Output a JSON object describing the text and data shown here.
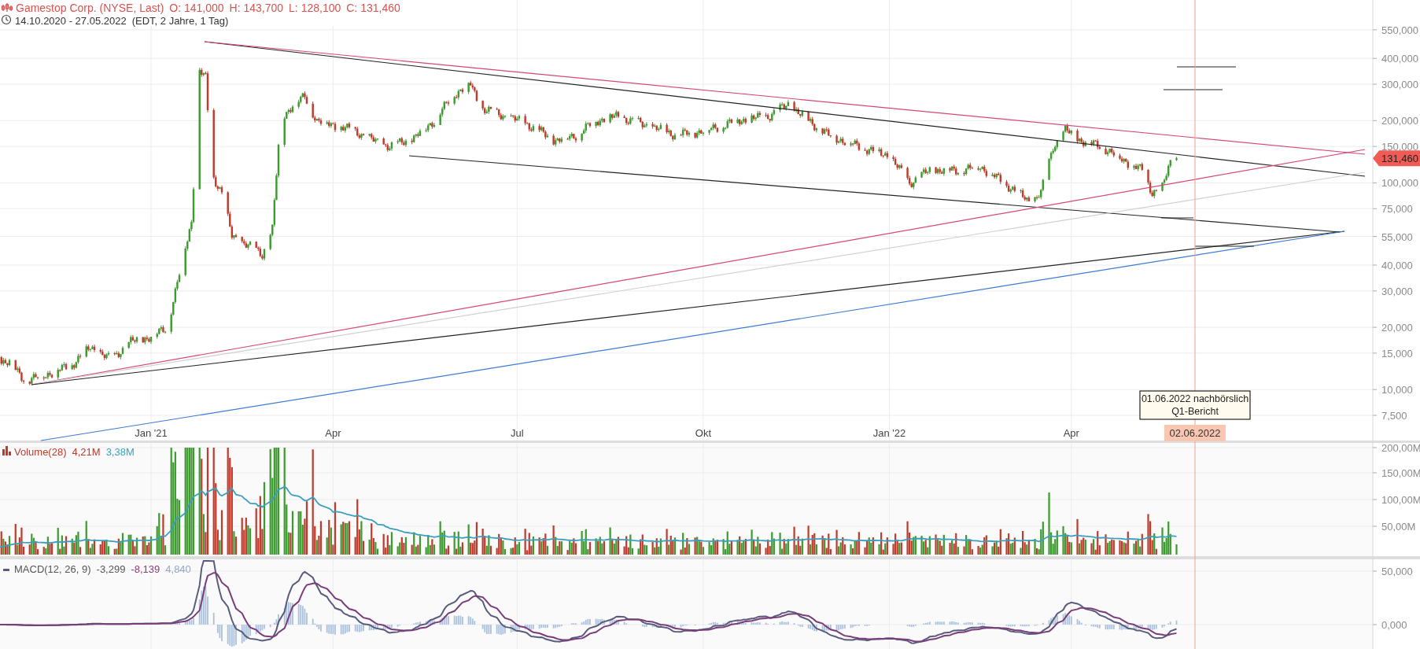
{
  "header": {
    "title": "Gamestop Corp. (NYSE, Last)",
    "open": "O: 141,000",
    "high": "H: 143,700",
    "low": "L: 128,100",
    "close": "C: 131,460",
    "range": "14.10.2020 - 27.05.2022",
    "range_detail": "(EDT, 2 Jahre, 1 Tag)"
  },
  "price_axis": {
    "ticks": [
      "550,000",
      "400,000",
      "300,000",
      "200,000",
      "150,000",
      "100,000",
      "75,000",
      "55,000",
      "40,000",
      "30,000",
      "20,000",
      "15,000",
      "10,000",
      "7,500"
    ],
    "last_price": "131,460"
  },
  "time_axis": {
    "labels": [
      "Jan '21",
      "Apr",
      "Jul",
      "Okt",
      "Jan '22",
      "Apr"
    ],
    "cursor_date": "02.06.2022"
  },
  "event_note": {
    "lines": [
      "01.06.2022 nachbörslich",
      "Q1-Bericht"
    ]
  },
  "volume": {
    "label": "Volume(28)",
    "value": "4,21M",
    "average": "3,38M",
    "ticks": [
      "200,00M",
      "150,00M",
      "100,00M",
      "50,00M"
    ]
  },
  "macd": {
    "label": "MACD(12, 26, 9)",
    "macd": "-3,299",
    "signal": "-8,139",
    "histogram": "4,840",
    "ticks": [
      "50,000",
      "0,000"
    ]
  }
}
